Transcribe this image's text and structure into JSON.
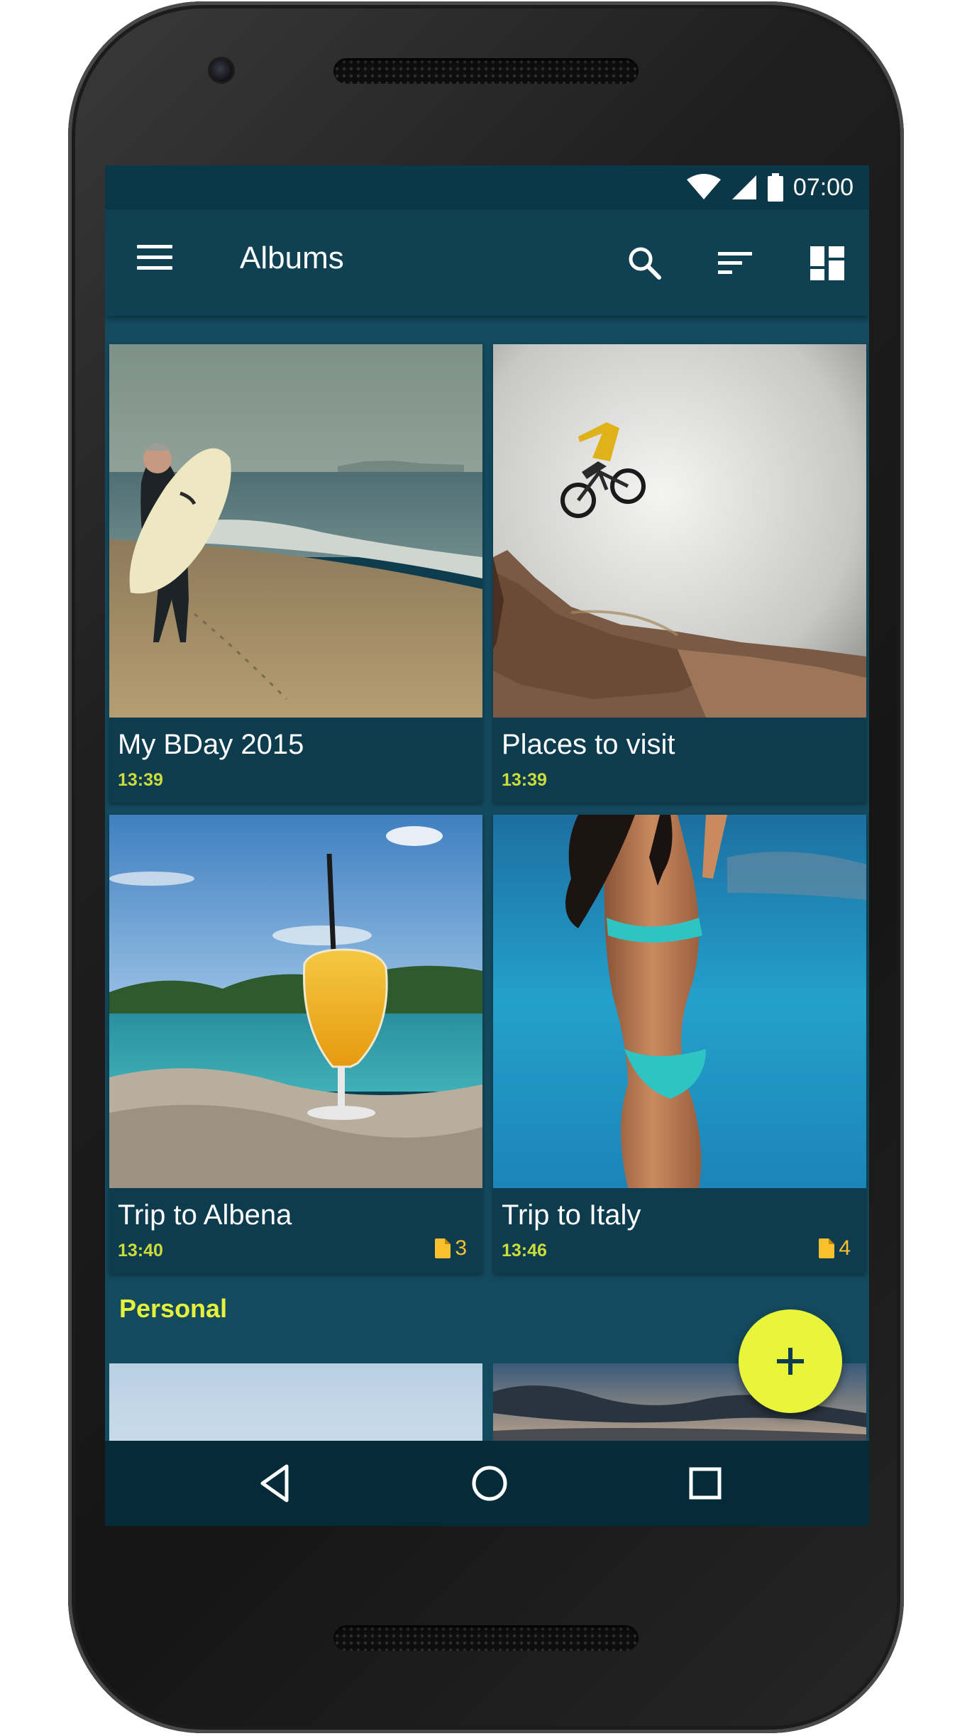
{
  "status_bar": {
    "time": "07:00",
    "icons": [
      "wifi-icon",
      "signal-icon",
      "battery-icon"
    ]
  },
  "app_bar": {
    "title": "Albums",
    "actions": [
      "search-icon",
      "sort-icon",
      "layout-icon"
    ]
  },
  "albums": [
    {
      "name": "My BDay 2015",
      "time": "13:39",
      "count": ""
    },
    {
      "name": "Places to visit",
      "time": "13:39",
      "count": ""
    },
    {
      "name": "Trip to Albena",
      "time": "13:40",
      "count": "3"
    },
    {
      "name": "Trip to Italy",
      "time": "13:46",
      "count": "4"
    }
  ],
  "section": {
    "label": "Personal"
  },
  "fab": {
    "icon": "plus-icon"
  },
  "nav": [
    "back-icon",
    "home-icon",
    "recents-icon"
  ],
  "colors": {
    "primary": "#104153",
    "background": "#144a5e",
    "accent": "#e8f53a",
    "time_text": "#cddc39",
    "count_text": "#fbc02d"
  }
}
